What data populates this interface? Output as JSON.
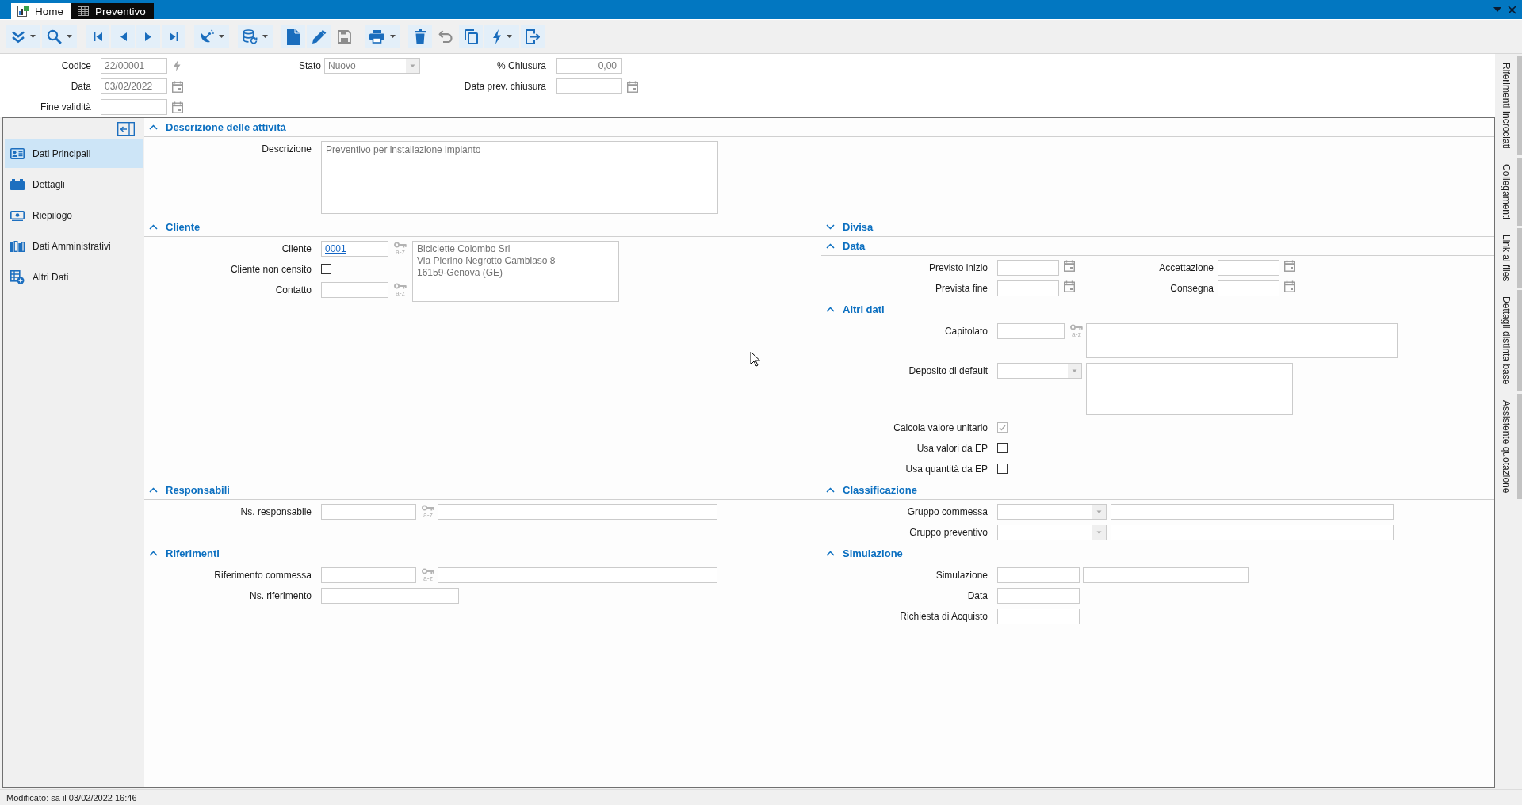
{
  "window": {
    "tabs": [
      {
        "label": "Home",
        "selected": false
      },
      {
        "label": "Preventivo",
        "selected": true
      }
    ]
  },
  "toolbar": {
    "groups": [
      {
        "buttons": [
          {
            "menu": true,
            "disabled": false
          },
          {
            "menu": true,
            "disabled": false
          }
        ]
      },
      {
        "buttons": [
          {
            "menu": false,
            "disabled": false
          },
          {
            "menu": false,
            "disabled": false
          },
          {
            "menu": false,
            "disabled": false
          },
          {
            "menu": false,
            "disabled": false
          }
        ]
      },
      {
        "buttons": [
          {
            "menu": true,
            "disabled": false
          }
        ]
      },
      {
        "buttons": [
          {
            "menu": true,
            "disabled": false
          }
        ]
      },
      {
        "buttons": [
          {
            "menu": false,
            "disabled": false
          },
          {
            "menu": false,
            "disabled": false
          },
          {
            "menu": false,
            "disabled": true
          }
        ]
      },
      {
        "buttons": [
          {
            "menu": true,
            "disabled": false
          }
        ]
      },
      {
        "buttons": [
          {
            "menu": false,
            "disabled": false
          },
          {
            "menu": false,
            "disabled": true
          },
          {
            "menu": false,
            "disabled": false
          },
          {
            "menu": true,
            "disabled": false
          },
          {
            "menu": false,
            "disabled": false
          }
        ]
      }
    ]
  },
  "header": {
    "columns": [
      {
        "fields": [
          {
            "kind": "code",
            "label": "Codice",
            "value": "22/00001"
          },
          {
            "kind": "date",
            "label": "Data",
            "value": "03/02/2022"
          },
          {
            "kind": "date",
            "label": "Fine validità"
          }
        ]
      },
      {
        "fields": [
          {
            "kind": "combo",
            "label": "Stato",
            "value": "Nuovo"
          }
        ]
      },
      {
        "fields": [
          {
            "kind": "number",
            "label": "% Chiusura",
            "value": "0,00"
          },
          {
            "kind": "date",
            "label": "Data prev. chiusura"
          }
        ]
      }
    ]
  },
  "sidebar": {
    "items": [
      {
        "label": "Dati Principali",
        "selected": true
      },
      {
        "label": "Dettagli",
        "selected": false
      },
      {
        "label": "Riepilogo",
        "selected": false
      },
      {
        "label": "Dati Amministrativi",
        "selected": false
      },
      {
        "label": "Altri Dati",
        "selected": false
      }
    ]
  },
  "sections": [
    {
      "title": "Descrizione delle attività",
      "expanded": true,
      "rows": [
        {
          "kind": "memo",
          "label": "Descrizione",
          "value": "Preventivo per installazione impianto"
        }
      ]
    }
  ],
  "bands": [
    {
      "left": [
        {
          "title": "Cliente",
          "expanded": true,
          "rows": [
            {
              "kind": "lookup",
              "label": "Cliente",
              "value": "0001",
              "key_label": "a-z"
            },
            {
              "kind": "check",
              "label": "Cliente non censito",
              "checked": false,
              "disabled": false
            },
            {
              "kind": "lookup",
              "label": "Contatto",
              "key_label": "a-z"
            }
          ],
          "info": [
            "Biciclette Colombo Srl",
            "Via Pierino Negrotto Cambiaso 8",
            "16159-Genova (GE)"
          ]
        }
      ],
      "right": [
        {
          "title": "Divisa",
          "expanded": false
        },
        {
          "title": "Data",
          "expanded": true,
          "rows": [
            {
              "fields": [
                {
                  "kind": "date",
                  "label": "Previsto inizio"
                },
                {
                  "kind": "date",
                  "label": "Accettazione"
                }
              ]
            },
            {
              "fields": [
                {
                  "kind": "date",
                  "label": "Prevista fine"
                },
                {
                  "kind": "date",
                  "label": "Consegna"
                }
              ]
            }
          ]
        },
        {
          "title": "Altri dati",
          "expanded": true,
          "rows": [
            {
              "fields": [
                {
                  "kind": "lookup",
                  "label": "Capitolato",
                  "key_label": "a-z"
                },
                {
                  "kind": "note"
                }
              ]
            },
            {
              "fields": [
                {
                  "kind": "combo",
                  "label": "Deposito di default"
                },
                {
                  "kind": "note"
                }
              ]
            },
            {
              "kind": "check",
              "label": "Calcola valore unitario",
              "checked": true,
              "disabled": true
            },
            {
              "kind": "check",
              "label": "Usa valori da EP",
              "checked": false,
              "disabled": false
            },
            {
              "kind": "check",
              "label": "Usa quantità da EP",
              "checked": false,
              "disabled": false
            }
          ]
        }
      ]
    },
    {
      "left": [
        {
          "title": "Responsabili",
          "expanded": true,
          "rows": [
            {
              "fields": [
                {
                  "kind": "lookup",
                  "label": "Ns. responsabile",
                  "key_label": "a-z"
                },
                {
                  "kind": "box"
                }
              ]
            }
          ]
        }
      ],
      "right": [
        {
          "title": "Classificazione",
          "expanded": true,
          "rows": [
            {
              "fields": [
                {
                  "kind": "combo",
                  "label": "Gruppo commessa"
                },
                {
                  "kind": "box"
                }
              ]
            },
            {
              "fields": [
                {
                  "kind": "combo",
                  "label": "Gruppo preventivo"
                },
                {
                  "kind": "box"
                }
              ]
            }
          ]
        }
      ]
    },
    {
      "left": [
        {
          "title": "Riferimenti",
          "expanded": true,
          "rows": [
            {
              "fields": [
                {
                  "kind": "lookup",
                  "label": "Riferimento commessa",
                  "key_label": "a-z"
                },
                {
                  "kind": "box"
                }
              ]
            },
            {
              "kind": "text",
              "label": "Ns. riferimento"
            }
          ]
        }
      ],
      "right": [
        {
          "title": "Simulazione",
          "expanded": true,
          "rows": [
            {
              "fields": [
                {
                  "kind": "text",
                  "label": "Simulazione"
                },
                {
                  "kind": "box"
                }
              ]
            },
            {
              "kind": "text",
              "label": "Data"
            },
            {
              "kind": "text",
              "label": "Richiesta di Acquisto"
            }
          ]
        }
      ]
    }
  ],
  "side_tabs": [
    {
      "label": "Riferimenti Incrociati",
      "selected": false
    },
    {
      "label": "Collegamenti",
      "selected": false
    },
    {
      "label": "Link ai files",
      "selected": false
    },
    {
      "label": "Dettagli distinta base",
      "selected": false
    },
    {
      "label": "Assistente quotazione",
      "selected": false
    }
  ],
  "status_bar": {
    "text": "Modificato: sa il 03/02/2022 16:46"
  }
}
